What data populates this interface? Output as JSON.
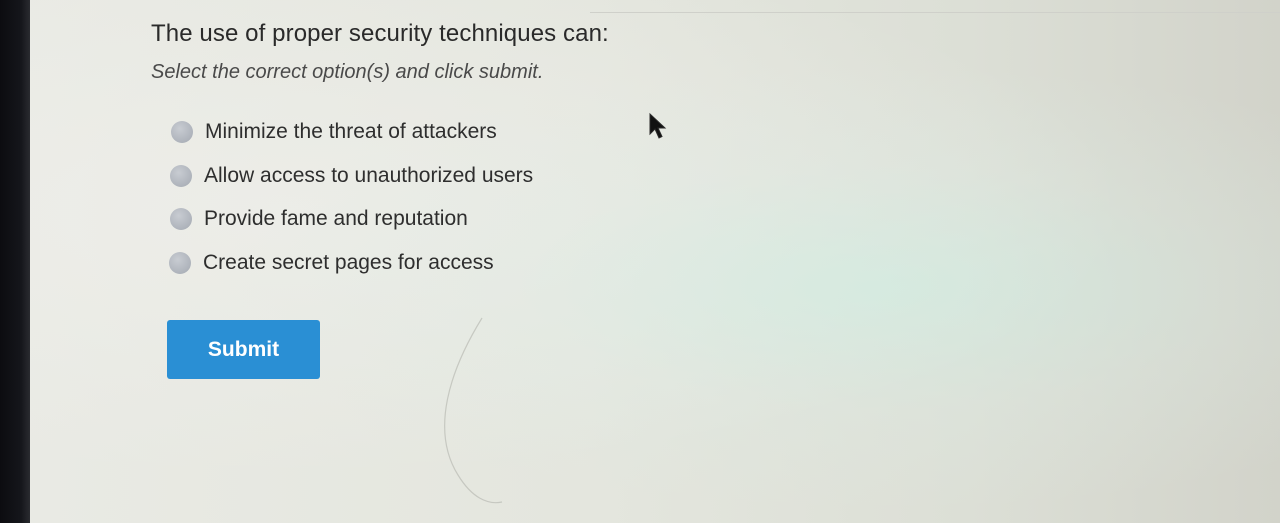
{
  "question": {
    "text": "The use of proper security techniques can:",
    "instruction": "Select the correct option(s) and click submit."
  },
  "options": [
    {
      "label": "Minimize the threat of attackers",
      "selected": false
    },
    {
      "label": "Allow access to unauthorized users",
      "selected": false
    },
    {
      "label": "Provide fame and reputation",
      "selected": false
    },
    {
      "label": "Create secret pages for access",
      "selected": false
    }
  ],
  "submit": {
    "label": "Submit",
    "color": "#2a8fd4"
  }
}
